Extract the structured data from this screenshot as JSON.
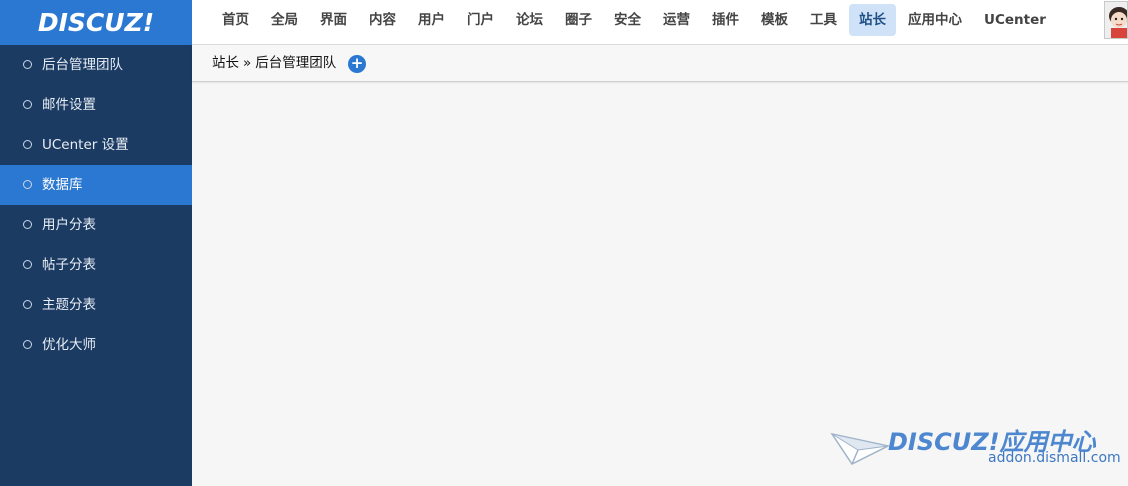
{
  "header": {
    "logo": "DISCUZ!",
    "nav": [
      "首页",
      "全局",
      "界面",
      "内容",
      "用户",
      "门户",
      "论坛",
      "圈子",
      "安全",
      "运营",
      "插件",
      "模板",
      "工具",
      "站长",
      "应用中心",
      "UCenter"
    ],
    "active_nav": "站长"
  },
  "sidebar": {
    "items": [
      "后台管理团队",
      "邮件设置",
      "UCenter 设置",
      "数据库",
      "用户分表",
      "帖子分表",
      "主题分表",
      "优化大师"
    ],
    "active_item": "数据库"
  },
  "breadcrumb": {
    "root": "站长",
    "separator": "»",
    "current": "后台管理团队"
  },
  "watermark": {
    "brand": "DISCUZ!应用中心",
    "url": "addon.dismall.com"
  },
  "colors": {
    "accent": "#2b78d2",
    "sidebar_bg": "#1b3b62",
    "nav_active_bg": "#cfe2f7"
  }
}
